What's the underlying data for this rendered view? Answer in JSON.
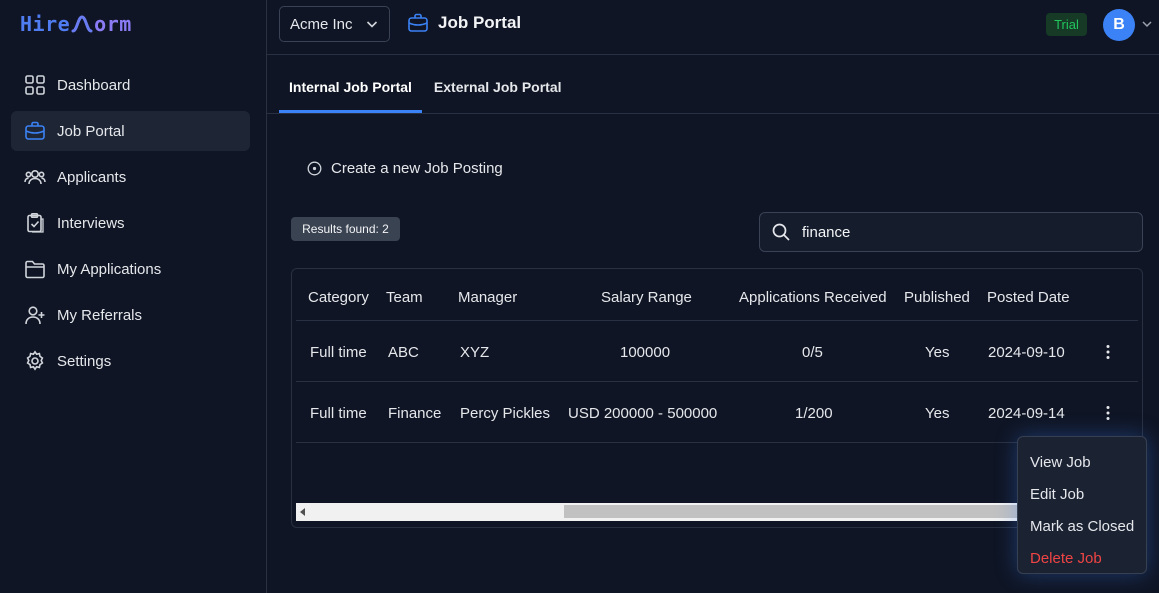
{
  "brand": {
    "part1": "Hire",
    "part2": "orm"
  },
  "sidebar": {
    "items": [
      {
        "label": "Dashboard",
        "icon": "grid-icon"
      },
      {
        "label": "Job Portal",
        "icon": "briefcase-icon",
        "active": true
      },
      {
        "label": "Applicants",
        "icon": "users-icon"
      },
      {
        "label": "Interviews",
        "icon": "clipboard-check-icon"
      },
      {
        "label": "My Applications",
        "icon": "folder-icon"
      },
      {
        "label": "My Referrals",
        "icon": "user-plus-icon"
      },
      {
        "label": "Settings",
        "icon": "gear-icon"
      }
    ]
  },
  "header": {
    "org": "Acme Inc",
    "title": "Job Portal",
    "trial": "Trial",
    "avatar": "B"
  },
  "tabs": [
    {
      "label": "Internal Job Portal",
      "active": true
    },
    {
      "label": "External Job Portal",
      "active": false
    }
  ],
  "actions": {
    "create": "Create a new Job Posting"
  },
  "results": "Results found: 2",
  "search": {
    "value": "finance"
  },
  "table": {
    "headers": [
      "Category",
      "Team",
      "Manager",
      "Salary Range",
      "Applications Received",
      "Published",
      "Posted Date"
    ],
    "rows": [
      [
        "Full time",
        "ABC",
        "XYZ",
        "100000",
        "0/5",
        "Yes",
        "2024-09-10"
      ],
      [
        "Full time",
        "Finance",
        "Percy Pickles",
        "USD 200000 - 500000",
        "1/200",
        "Yes",
        "2024-09-14"
      ]
    ]
  },
  "menu": {
    "items": [
      "View Job",
      "Edit Job",
      "Mark as Closed",
      "Delete Job"
    ]
  },
  "colors": {
    "accent": "#3b82f6",
    "trial": "#22c55e",
    "danger": "#ef4444",
    "background": "#0f1524"
  }
}
